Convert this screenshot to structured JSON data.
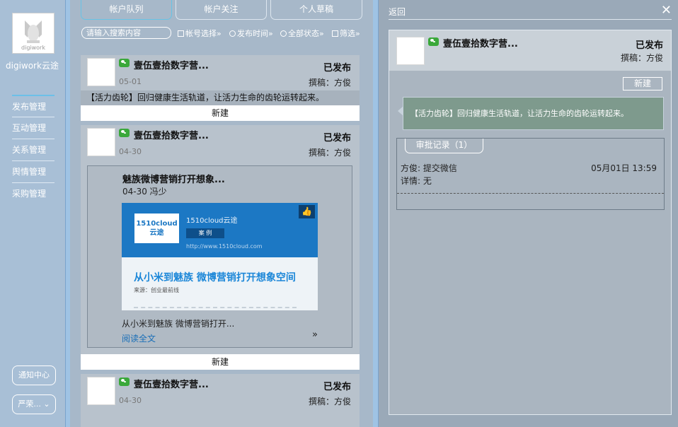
{
  "sidebar": {
    "logo_text": "digiwork",
    "brand": "digiwork云途",
    "nav": [
      "发布管理",
      "互动管理",
      "关系管理",
      "舆情管理",
      "采购管理"
    ],
    "notify_label": "通知中心",
    "user_label": "严荣..."
  },
  "tabs": [
    "帐户队列",
    "帐户关注",
    "个人草稿"
  ],
  "filters": {
    "search_placeholder": "请输入搜索内容",
    "account": "帐号选择»",
    "time": "发布时间»",
    "status": "全部状态»",
    "filter": "筛选»"
  },
  "cards": [
    {
      "title": "壹伍壹拾数字营...",
      "status": "已发布",
      "date": "05-01",
      "author": "撰稿：方俊",
      "body": "【活力齿轮】回归健康生活轨道，让活力生命的齿轮运转起来。",
      "new_label": "新建"
    },
    {
      "title": "壹伍壹拾数字营...",
      "status": "已发布",
      "date": "04-30",
      "author": "撰稿：方俊",
      "new_label": "新建",
      "article": {
        "title": "魅族微博营销打开想象...",
        "meta": "04-30 冯少",
        "img_logo": "1510cloud",
        "img_logo_sub": "云途",
        "img_line1": "1510cloud云途",
        "img_tag": "案 例",
        "img_url": "http://www.1510cloud.com",
        "img_headline": "从小米到魅族 微博营销打开想象空间",
        "img_source": "来源：创业最前线",
        "summary": "从小米到魅族 微博营销打开...",
        "read_more": "阅读全文",
        "more": "»"
      }
    },
    {
      "title": "壹伍壹拾数字营...",
      "status": "已发布",
      "date": "04-30",
      "author": "撰稿：方俊"
    }
  ],
  "detail": {
    "back": "返回",
    "close": "✕",
    "title": "壹伍壹拾数字营...",
    "status": "已发布",
    "author": "撰稿：方俊",
    "new_label": "新建",
    "message": "【活力齿轮】回归健康生活轨道，让活力生命的齿轮运转起来。",
    "record_tab": "审批记录（1）",
    "record_action": "方俊: 提交微信",
    "record_detail": "详情: 无",
    "record_time": "05月01日 13:59"
  }
}
